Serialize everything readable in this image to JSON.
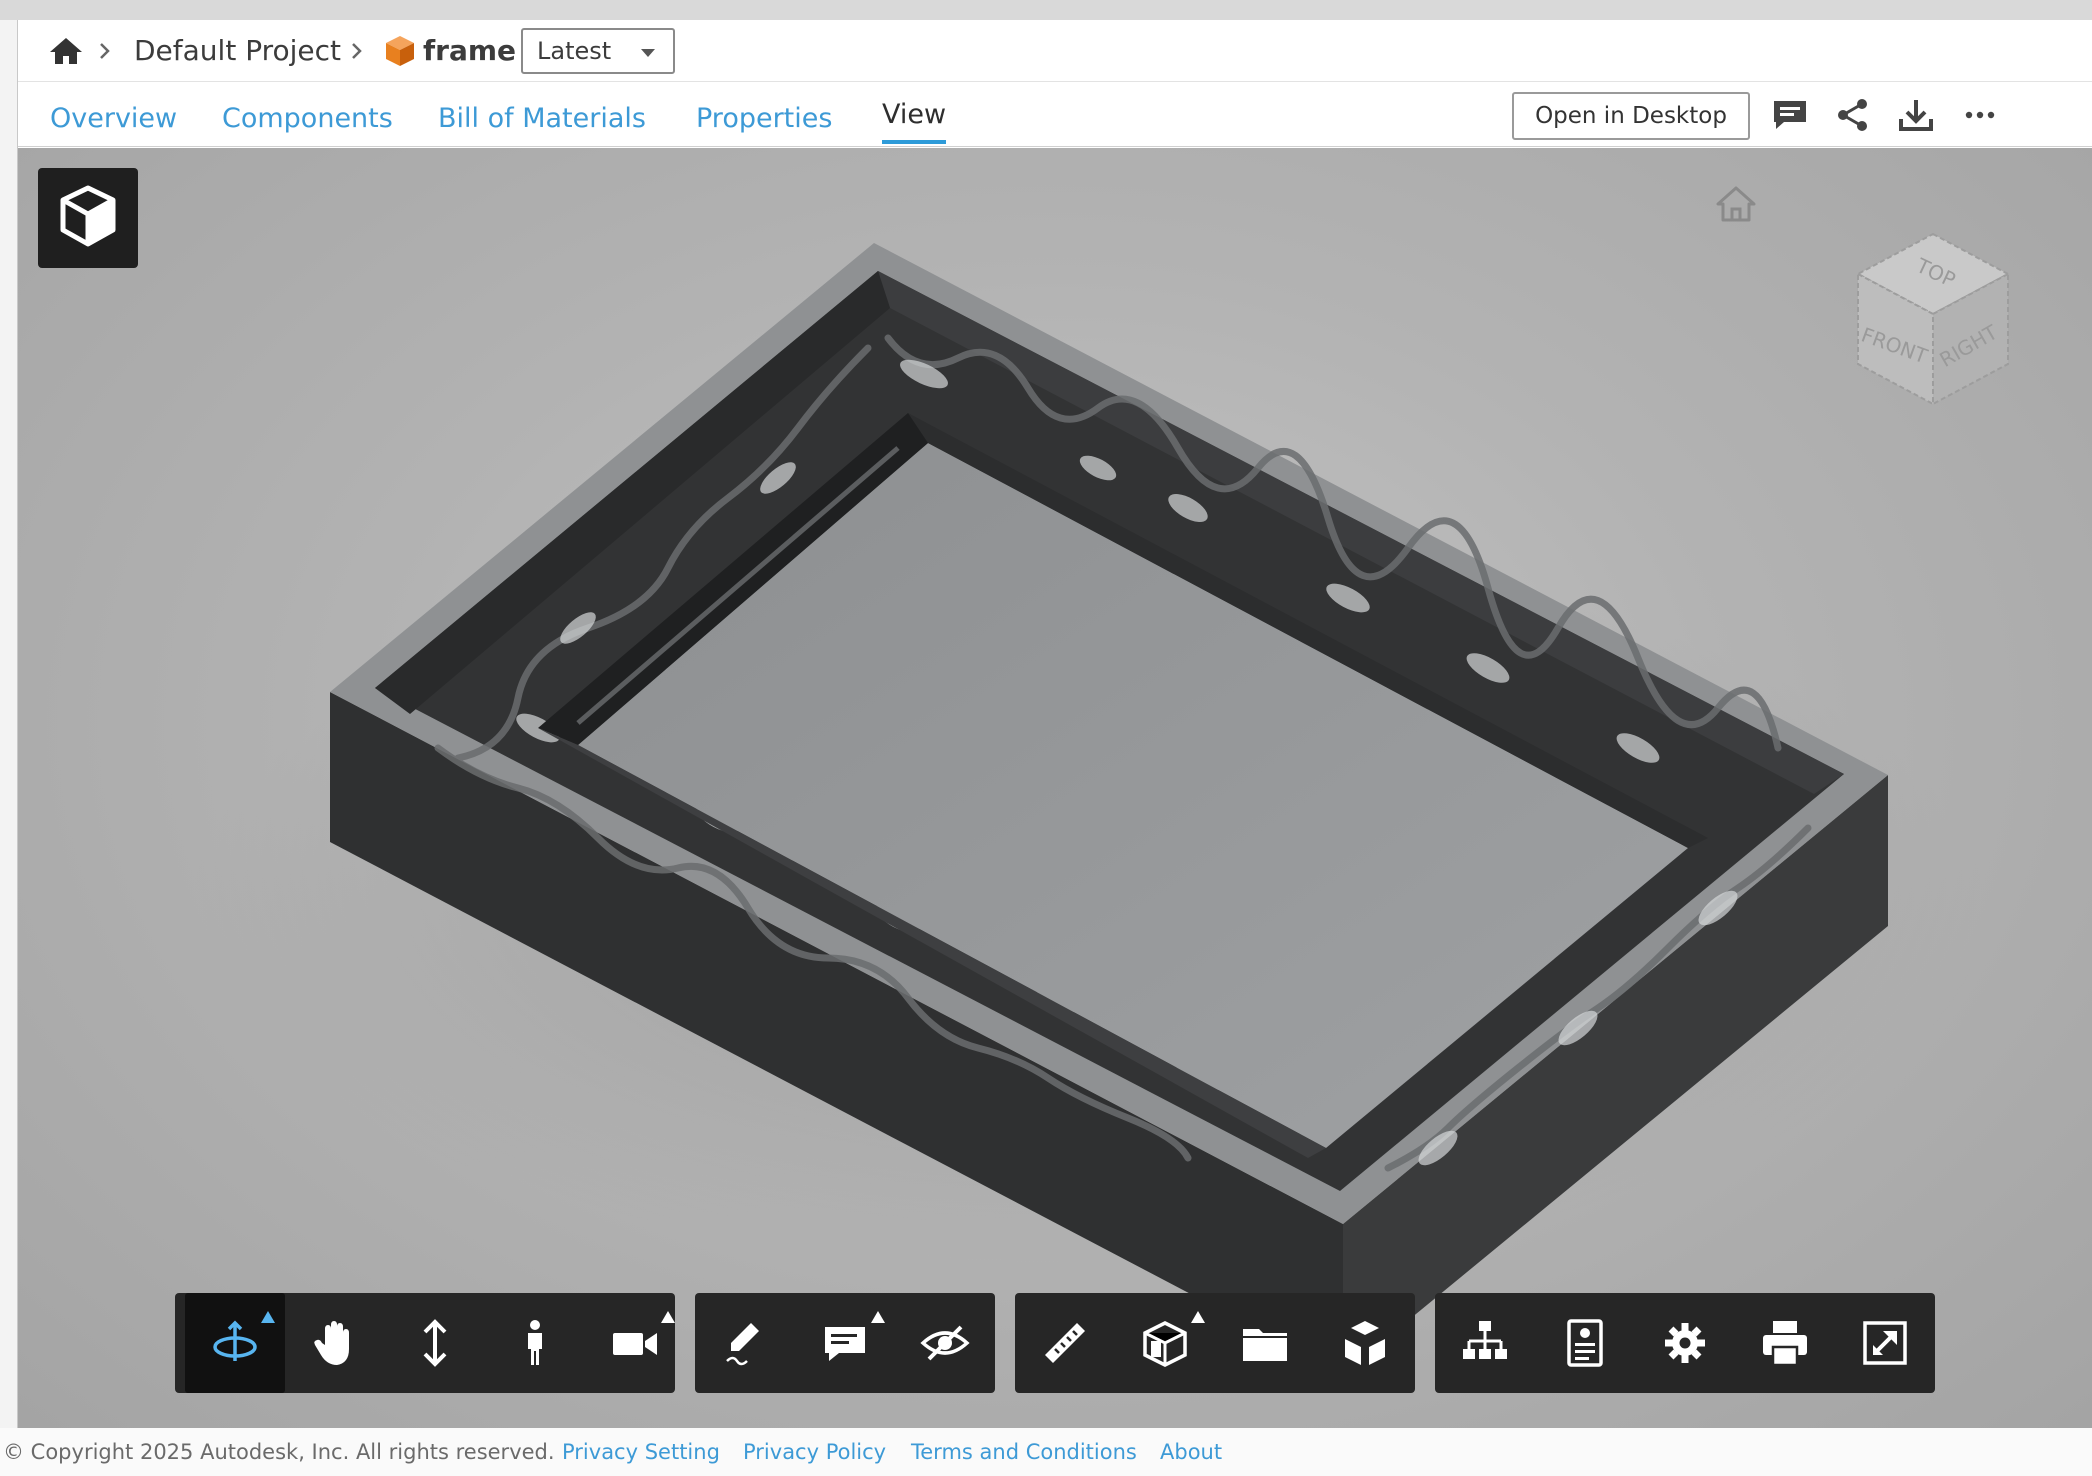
{
  "breadcrumb": {
    "project": "Default Project",
    "file": "frame",
    "version": "Latest"
  },
  "tabs": [
    {
      "label": "Overview",
      "active": false
    },
    {
      "label": "Components",
      "active": false
    },
    {
      "label": "Bill of Materials",
      "active": false
    },
    {
      "label": "Properties",
      "active": false
    },
    {
      "label": "View",
      "active": true
    }
  ],
  "actions": {
    "open_desktop": "Open in Desktop",
    "icons": [
      "comment-icon",
      "share-icon",
      "download-icon",
      "more-icon"
    ]
  },
  "viewer": {
    "viewcube": {
      "top": "TOP",
      "front": "FRONT",
      "right": "RIGHT"
    },
    "model_color": "#343536"
  },
  "toolbar": {
    "groups": [
      [
        "orbit-icon",
        "pan-icon",
        "zoom-icon",
        "walk-icon",
        "camera-icon"
      ],
      [
        "markup-icon",
        "comment-icon",
        "hide-icon"
      ],
      [
        "measure-icon",
        "section-icon",
        "folder-icon",
        "explode-icon"
      ],
      [
        "model-browser-icon",
        "properties-icon",
        "settings-icon",
        "print-icon",
        "fullscreen-icon"
      ]
    ],
    "active": "orbit-icon",
    "accent": "#58b5f0"
  },
  "footer": {
    "copyright": "© Copyright 2025 Autodesk, Inc. All rights reserved.",
    "links": [
      "Privacy Setting",
      "Privacy Policy",
      "Terms and Conditions",
      "About"
    ]
  },
  "colors": {
    "link": "#3d9ad6",
    "tab_underline": "#2e9bd9",
    "toolbar_bg": "#262626"
  }
}
